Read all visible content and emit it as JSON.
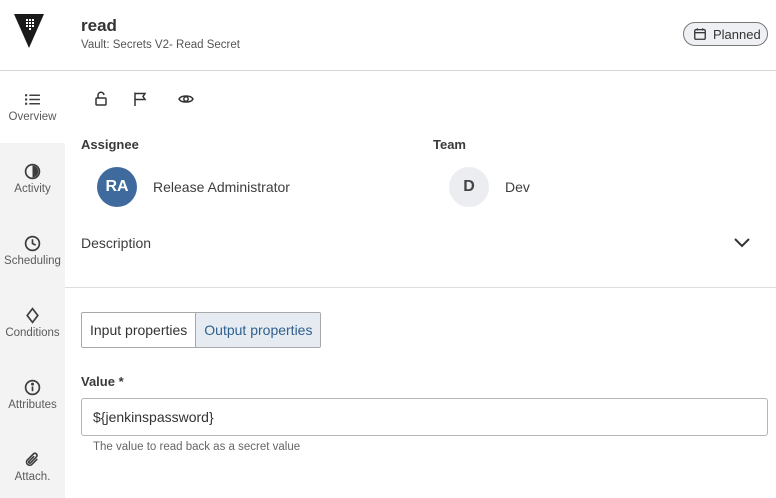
{
  "header": {
    "title": "read",
    "subtitle": "Vault: Secrets V2- Read Secret",
    "status": "Planned"
  },
  "sidebar": {
    "items": [
      {
        "label": "Overview",
        "icon": "list-icon"
      },
      {
        "label": "Activity",
        "icon": "clock-half-icon"
      },
      {
        "label": "Scheduling",
        "icon": "clock-icon"
      },
      {
        "label": "Conditions",
        "icon": "diamond-icon"
      },
      {
        "label": "Attributes",
        "icon": "info-icon"
      },
      {
        "label": "Attach.",
        "icon": "paperclip-icon"
      }
    ]
  },
  "toolbar": {
    "icons": [
      "unlock-icon",
      "flag-icon",
      "eye-icon"
    ]
  },
  "assignee": {
    "label": "Assignee",
    "initials": "RA",
    "name": "Release Administrator"
  },
  "team": {
    "label": "Team",
    "initials": "D",
    "name": "Dev"
  },
  "description": {
    "label": "Description"
  },
  "tabs": [
    {
      "label": "Input properties",
      "selected": false
    },
    {
      "label": "Output properties",
      "selected": true
    }
  ],
  "value_field": {
    "label": "Value *",
    "value": "${jenkinspassword}",
    "helper": "The value to read back as a secret value"
  },
  "colors": {
    "accent": "#3e6a9e",
    "selected_tab_bg": "#e6ebf2",
    "sidebar_bg": "#f3f3f4"
  }
}
